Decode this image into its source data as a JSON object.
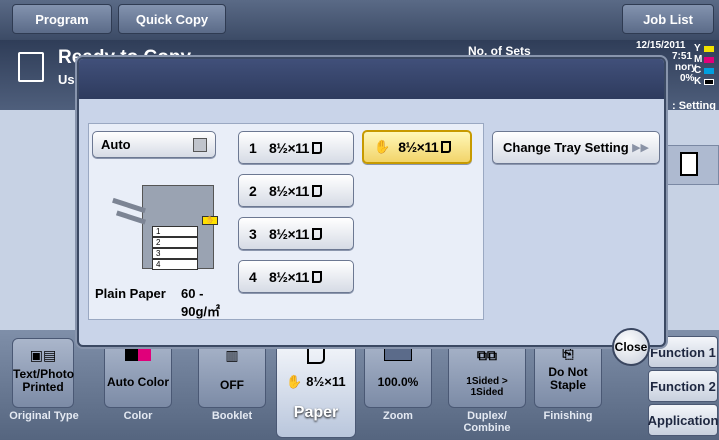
{
  "top_bar": {
    "program_tab": "Program",
    "quick_copy_tab": "Quick Copy",
    "job_list_tab": "Job List"
  },
  "status": {
    "ready_text": "Ready to Copy",
    "user_fragment": "Use",
    "sets_label": "No. of Sets",
    "date": "12/15/2011",
    "time_fragment": "7:51",
    "memory_fragment": "nory",
    "percent_fragment": "0%",
    "toner": [
      "Y",
      "M",
      "C",
      "K"
    ],
    "toner_colors": [
      "#f2e200",
      "#e0007a",
      "#00a0e0",
      "#000000"
    ],
    "setting_fragment": ": Setting"
  },
  "dialog": {
    "auto_label": "Auto",
    "trays": [
      {
        "number": "1",
        "size": "8½×11"
      },
      {
        "number": "2",
        "size": "8½×11"
      },
      {
        "number": "3",
        "size": "8½×11"
      },
      {
        "number": "4",
        "size": "8½×11"
      }
    ],
    "bypass_size": "8½×11",
    "diagram_trays": [
      "1",
      "2",
      "3",
      "4"
    ],
    "paper_type": "Plain Paper",
    "paper_weight": "60 -",
    "paper_weight_unit": "90g/㎡",
    "change_tray_label": "Change Tray Setting",
    "close_label": "Close"
  },
  "bottom": {
    "items": [
      {
        "value": "Text/Photo\nPrinted",
        "label": "Original Type"
      },
      {
        "value": "Auto Color",
        "label": "Color"
      },
      {
        "value": "OFF",
        "label": "Booklet"
      },
      {
        "value": "8½×11",
        "label": "Paper"
      },
      {
        "value": "100.0%",
        "label": "Zoom"
      },
      {
        "value": "1Sided > 1Sided",
        "label": "Duplex/\nCombine"
      },
      {
        "value": "Do Not\nStaple",
        "label": "Finishing"
      }
    ],
    "function1": "Function 1",
    "function2": "Function 2",
    "application": "Application"
  },
  "colors": {
    "accent": "#f2d46a",
    "header": "#2e3b5e"
  }
}
